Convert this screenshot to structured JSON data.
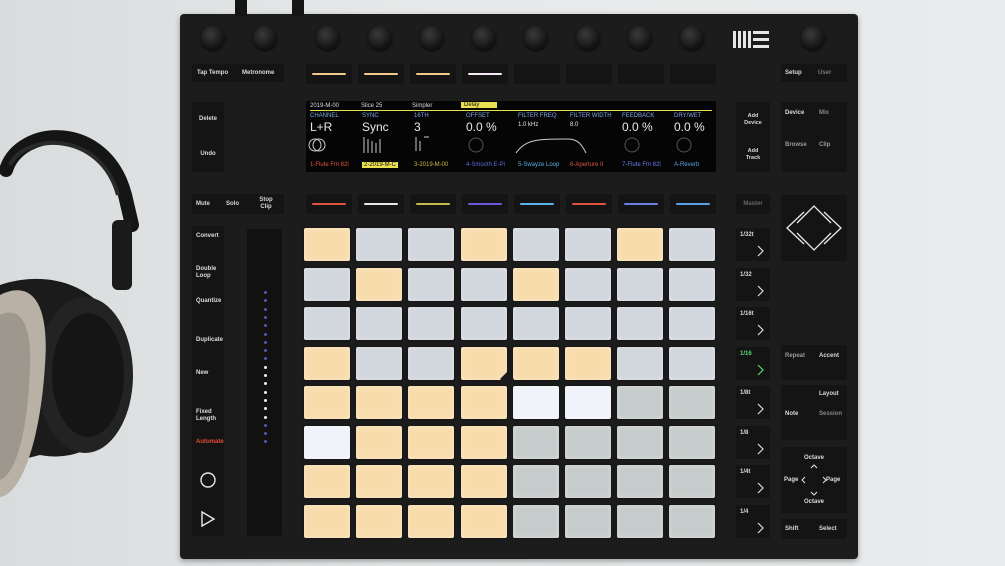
{
  "buttons": {
    "tap_tempo": "Tap Tempo",
    "metronome": "Metronome",
    "setup": "Setup",
    "user": "User",
    "delete": "Delete",
    "undo": "Undo",
    "add_device": "Add Device",
    "add_track": "Add Track",
    "device": "Device",
    "mix": "Mix",
    "browse": "Browse",
    "clip": "Clip",
    "mute": "Mute",
    "solo": "Solo",
    "stop_clip": "Stop Clip",
    "master": "Master",
    "convert": "Convert",
    "double_loop": "Double Loop",
    "quantize": "Quantize",
    "duplicate": "Duplicate",
    "new": "New",
    "fixed_length": "Fixed Length",
    "automate": "Automate",
    "repeat": "Repeat",
    "accent": "Accent",
    "layout": "Layout",
    "note": "Note",
    "session": "Session",
    "octave_up": "Octave",
    "octave_down": "Octave",
    "page_left": "Page",
    "page_right": "Page",
    "shift": "Shift",
    "select": "Select"
  },
  "scene_buttons": [
    "1/32t",
    "1/32",
    "1/16t",
    "1/16",
    "1/8t",
    "1/8",
    "1/4t",
    "1/4"
  ],
  "screen": {
    "tabs": [
      "2019-M-00",
      "Slice 25",
      "Simpler",
      "Delay"
    ],
    "params": [
      {
        "name": "CHANNEL",
        "value": "L+R"
      },
      {
        "name": "SYNC",
        "value": "Sync"
      },
      {
        "name": "16TH",
        "value": "3"
      },
      {
        "name": "OFFSET",
        "value": "0.0 %"
      },
      {
        "name": "FILTER FREQ",
        "value": "1.0 kHz"
      },
      {
        "name": "FILTER WIDTH",
        "value": "8.0"
      },
      {
        "name": "FEEDBACK",
        "value": "0.0 %"
      },
      {
        "name": "DRY/WET",
        "value": "0.0 %"
      }
    ],
    "tracks": [
      "1-Flute Fm 82l",
      "2-2019-M-C",
      "3-2019-M-00",
      "4-Smooth E-Pi",
      "5-Swayze Loop",
      "6-Aperture II",
      "7-Flute Fm 82l",
      "A-Reverb"
    ],
    "track_colors": [
      "#e0543f",
      "#d8d8d8",
      "#c9b84a",
      "#5a6ad8",
      "#5ab0e8",
      "#e0543f",
      "#6b7de8",
      "#5aa0e8"
    ]
  },
  "pads": [
    [
      "warm",
      "cool",
      "cool",
      "warm",
      "cool",
      "cool",
      "warm",
      "cool"
    ],
    [
      "cool",
      "warm",
      "cool",
      "cool",
      "warm",
      "cool",
      "cool",
      "cool"
    ],
    [
      "cool",
      "cool",
      "cool",
      "cool",
      "cool",
      "cool",
      "cool",
      "cool"
    ],
    [
      "warm",
      "cool",
      "cool",
      "warm",
      "warm",
      "warm",
      "cool",
      "cool"
    ],
    [
      "warm",
      "warm",
      "warm",
      "warm",
      "white",
      "white",
      "gray",
      "gray"
    ],
    [
      "white",
      "warm",
      "warm",
      "warm",
      "gray",
      "gray",
      "gray",
      "gray"
    ],
    [
      "warm",
      "warm",
      "warm",
      "warm",
      "gray",
      "gray",
      "gray",
      "gray"
    ],
    [
      "warm",
      "warm",
      "warm",
      "warm",
      "gray",
      "gray",
      "gray",
      "gray"
    ]
  ],
  "colors": {
    "warm": "#f8dcac",
    "cool": "#d2d6dd",
    "white": "#f1f3fa",
    "gray": "#c6cccb",
    "accent_red": "#e24a3b",
    "accent_green": "#5bd96a",
    "tab_highlight": "#e8e050"
  }
}
